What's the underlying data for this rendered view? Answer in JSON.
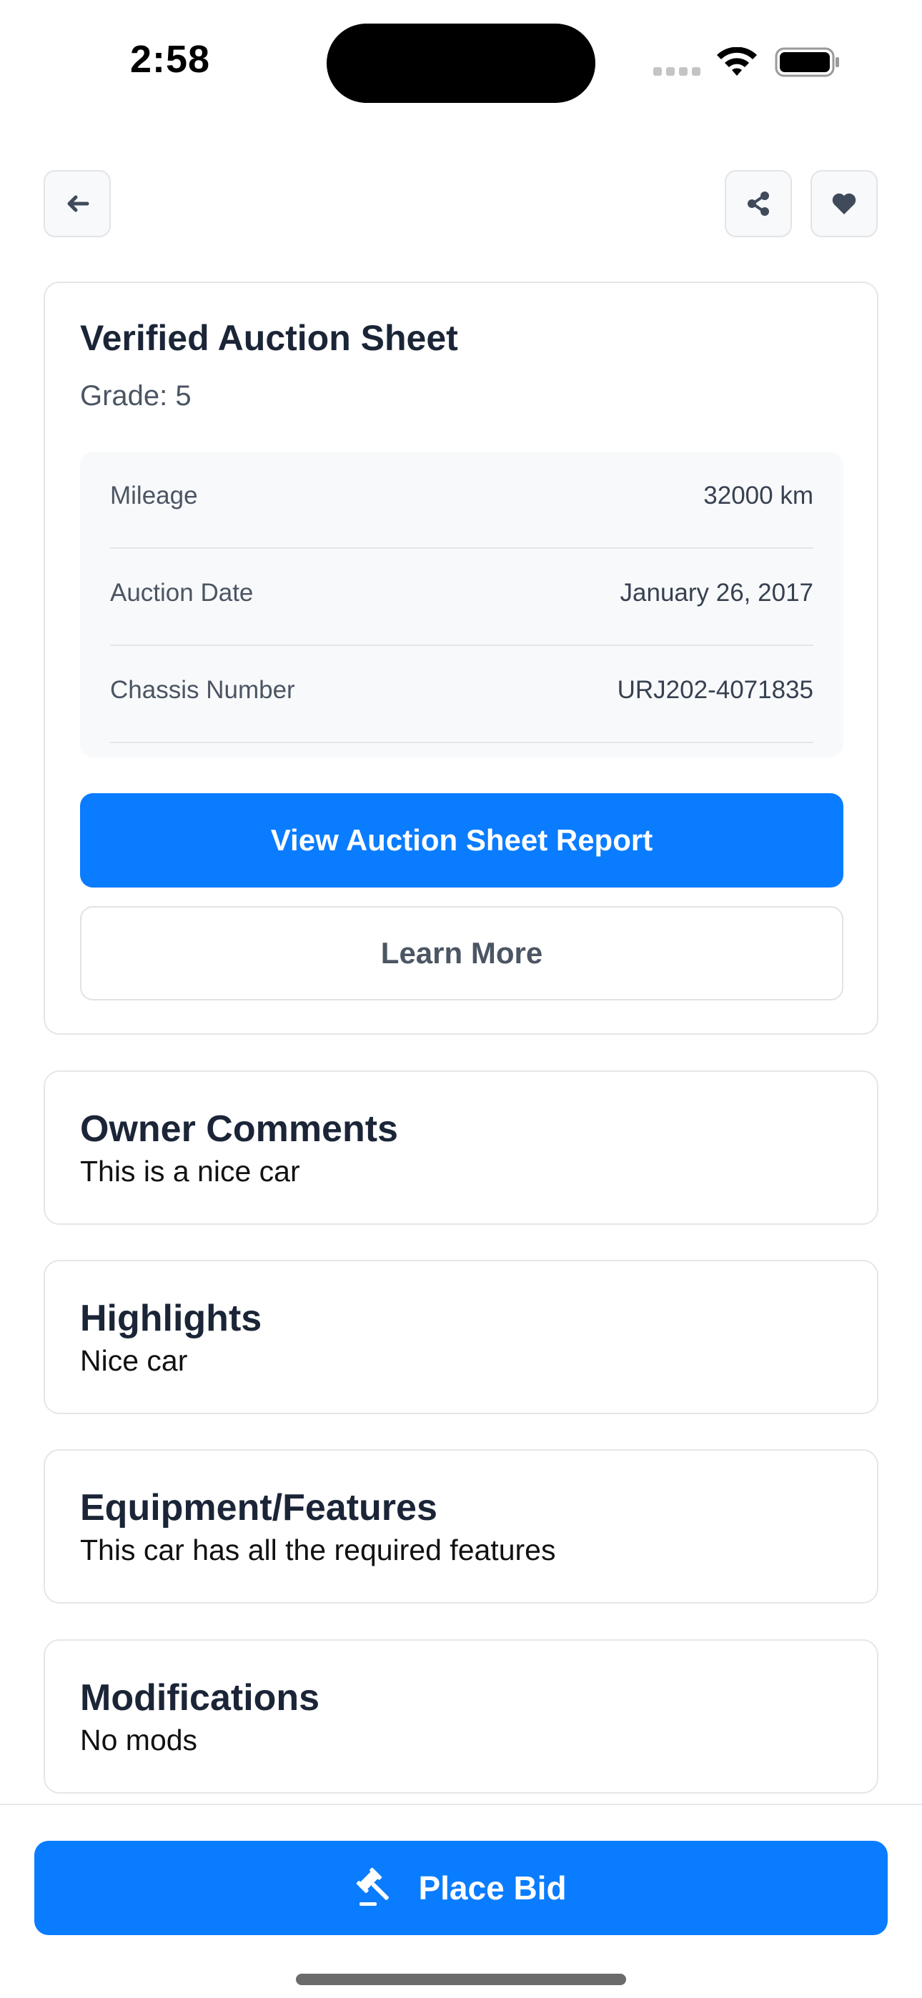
{
  "status_bar": {
    "time": "2:58"
  },
  "header": {
    "back_icon": "arrow-left-icon",
    "share_icon": "share-icon",
    "favorite_icon": "heart-icon"
  },
  "auction_sheet": {
    "title": "Verified Auction Sheet",
    "grade": "Grade: 5",
    "details": [
      {
        "label": "Mileage",
        "value": "32000 km"
      },
      {
        "label": "Auction Date",
        "value": "January 26, 2017"
      },
      {
        "label": "Chassis Number",
        "value": "URJ202-4071835"
      }
    ],
    "view_report_label": "View Auction Sheet Report",
    "learn_more_label": "Learn More"
  },
  "sections": [
    {
      "title": "Owner Comments",
      "body": "This is a nice car"
    },
    {
      "title": "Highlights",
      "body": "Nice car"
    },
    {
      "title": "Equipment/Features",
      "body": "This car has all the required features"
    },
    {
      "title": "Modifications",
      "body": "No mods"
    }
  ],
  "footer": {
    "place_bid_label": "Place Bid",
    "place_bid_icon": "gavel-icon"
  },
  "colors": {
    "primary": "#0a7cff",
    "heading": "#1b2537",
    "muted_text": "#4b5563",
    "panel_background": "#f8f9fa",
    "border": "#e4e6ea"
  }
}
